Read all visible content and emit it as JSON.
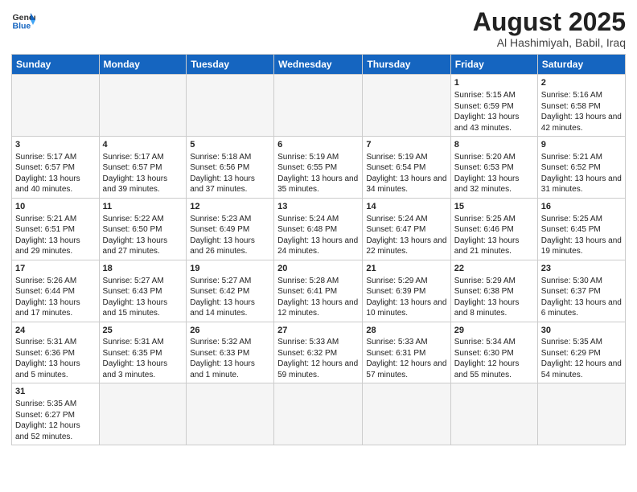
{
  "logo": {
    "text_general": "General",
    "text_blue": "Blue"
  },
  "header": {
    "month": "August 2025",
    "location": "Al Hashimiyah, Babil, Iraq"
  },
  "days_of_week": [
    "Sunday",
    "Monday",
    "Tuesday",
    "Wednesday",
    "Thursday",
    "Friday",
    "Saturday"
  ],
  "weeks": [
    [
      {
        "day": "",
        "info": ""
      },
      {
        "day": "",
        "info": ""
      },
      {
        "day": "",
        "info": ""
      },
      {
        "day": "",
        "info": ""
      },
      {
        "day": "",
        "info": ""
      },
      {
        "day": "1",
        "info": "Sunrise: 5:15 AM\nSunset: 6:59 PM\nDaylight: 13 hours and 43 minutes."
      },
      {
        "day": "2",
        "info": "Sunrise: 5:16 AM\nSunset: 6:58 PM\nDaylight: 13 hours and 42 minutes."
      }
    ],
    [
      {
        "day": "3",
        "info": "Sunrise: 5:17 AM\nSunset: 6:57 PM\nDaylight: 13 hours and 40 minutes."
      },
      {
        "day": "4",
        "info": "Sunrise: 5:17 AM\nSunset: 6:57 PM\nDaylight: 13 hours and 39 minutes."
      },
      {
        "day": "5",
        "info": "Sunrise: 5:18 AM\nSunset: 6:56 PM\nDaylight: 13 hours and 37 minutes."
      },
      {
        "day": "6",
        "info": "Sunrise: 5:19 AM\nSunset: 6:55 PM\nDaylight: 13 hours and 35 minutes."
      },
      {
        "day": "7",
        "info": "Sunrise: 5:19 AM\nSunset: 6:54 PM\nDaylight: 13 hours and 34 minutes."
      },
      {
        "day": "8",
        "info": "Sunrise: 5:20 AM\nSunset: 6:53 PM\nDaylight: 13 hours and 32 minutes."
      },
      {
        "day": "9",
        "info": "Sunrise: 5:21 AM\nSunset: 6:52 PM\nDaylight: 13 hours and 31 minutes."
      }
    ],
    [
      {
        "day": "10",
        "info": "Sunrise: 5:21 AM\nSunset: 6:51 PM\nDaylight: 13 hours and 29 minutes."
      },
      {
        "day": "11",
        "info": "Sunrise: 5:22 AM\nSunset: 6:50 PM\nDaylight: 13 hours and 27 minutes."
      },
      {
        "day": "12",
        "info": "Sunrise: 5:23 AM\nSunset: 6:49 PM\nDaylight: 13 hours and 26 minutes."
      },
      {
        "day": "13",
        "info": "Sunrise: 5:24 AM\nSunset: 6:48 PM\nDaylight: 13 hours and 24 minutes."
      },
      {
        "day": "14",
        "info": "Sunrise: 5:24 AM\nSunset: 6:47 PM\nDaylight: 13 hours and 22 minutes."
      },
      {
        "day": "15",
        "info": "Sunrise: 5:25 AM\nSunset: 6:46 PM\nDaylight: 13 hours and 21 minutes."
      },
      {
        "day": "16",
        "info": "Sunrise: 5:25 AM\nSunset: 6:45 PM\nDaylight: 13 hours and 19 minutes."
      }
    ],
    [
      {
        "day": "17",
        "info": "Sunrise: 5:26 AM\nSunset: 6:44 PM\nDaylight: 13 hours and 17 minutes."
      },
      {
        "day": "18",
        "info": "Sunrise: 5:27 AM\nSunset: 6:43 PM\nDaylight: 13 hours and 15 minutes."
      },
      {
        "day": "19",
        "info": "Sunrise: 5:27 AM\nSunset: 6:42 PM\nDaylight: 13 hours and 14 minutes."
      },
      {
        "day": "20",
        "info": "Sunrise: 5:28 AM\nSunset: 6:41 PM\nDaylight: 13 hours and 12 minutes."
      },
      {
        "day": "21",
        "info": "Sunrise: 5:29 AM\nSunset: 6:39 PM\nDaylight: 13 hours and 10 minutes."
      },
      {
        "day": "22",
        "info": "Sunrise: 5:29 AM\nSunset: 6:38 PM\nDaylight: 13 hours and 8 minutes."
      },
      {
        "day": "23",
        "info": "Sunrise: 5:30 AM\nSunset: 6:37 PM\nDaylight: 13 hours and 6 minutes."
      }
    ],
    [
      {
        "day": "24",
        "info": "Sunrise: 5:31 AM\nSunset: 6:36 PM\nDaylight: 13 hours and 5 minutes."
      },
      {
        "day": "25",
        "info": "Sunrise: 5:31 AM\nSunset: 6:35 PM\nDaylight: 13 hours and 3 minutes."
      },
      {
        "day": "26",
        "info": "Sunrise: 5:32 AM\nSunset: 6:33 PM\nDaylight: 13 hours and 1 minute."
      },
      {
        "day": "27",
        "info": "Sunrise: 5:33 AM\nSunset: 6:32 PM\nDaylight: 12 hours and 59 minutes."
      },
      {
        "day": "28",
        "info": "Sunrise: 5:33 AM\nSunset: 6:31 PM\nDaylight: 12 hours and 57 minutes."
      },
      {
        "day": "29",
        "info": "Sunrise: 5:34 AM\nSunset: 6:30 PM\nDaylight: 12 hours and 55 minutes."
      },
      {
        "day": "30",
        "info": "Sunrise: 5:35 AM\nSunset: 6:29 PM\nDaylight: 12 hours and 54 minutes."
      }
    ],
    [
      {
        "day": "31",
        "info": "Sunrise: 5:35 AM\nSunset: 6:27 PM\nDaylight: 12 hours and 52 minutes."
      },
      {
        "day": "",
        "info": ""
      },
      {
        "day": "",
        "info": ""
      },
      {
        "day": "",
        "info": ""
      },
      {
        "day": "",
        "info": ""
      },
      {
        "day": "",
        "info": ""
      },
      {
        "day": "",
        "info": ""
      }
    ]
  ]
}
